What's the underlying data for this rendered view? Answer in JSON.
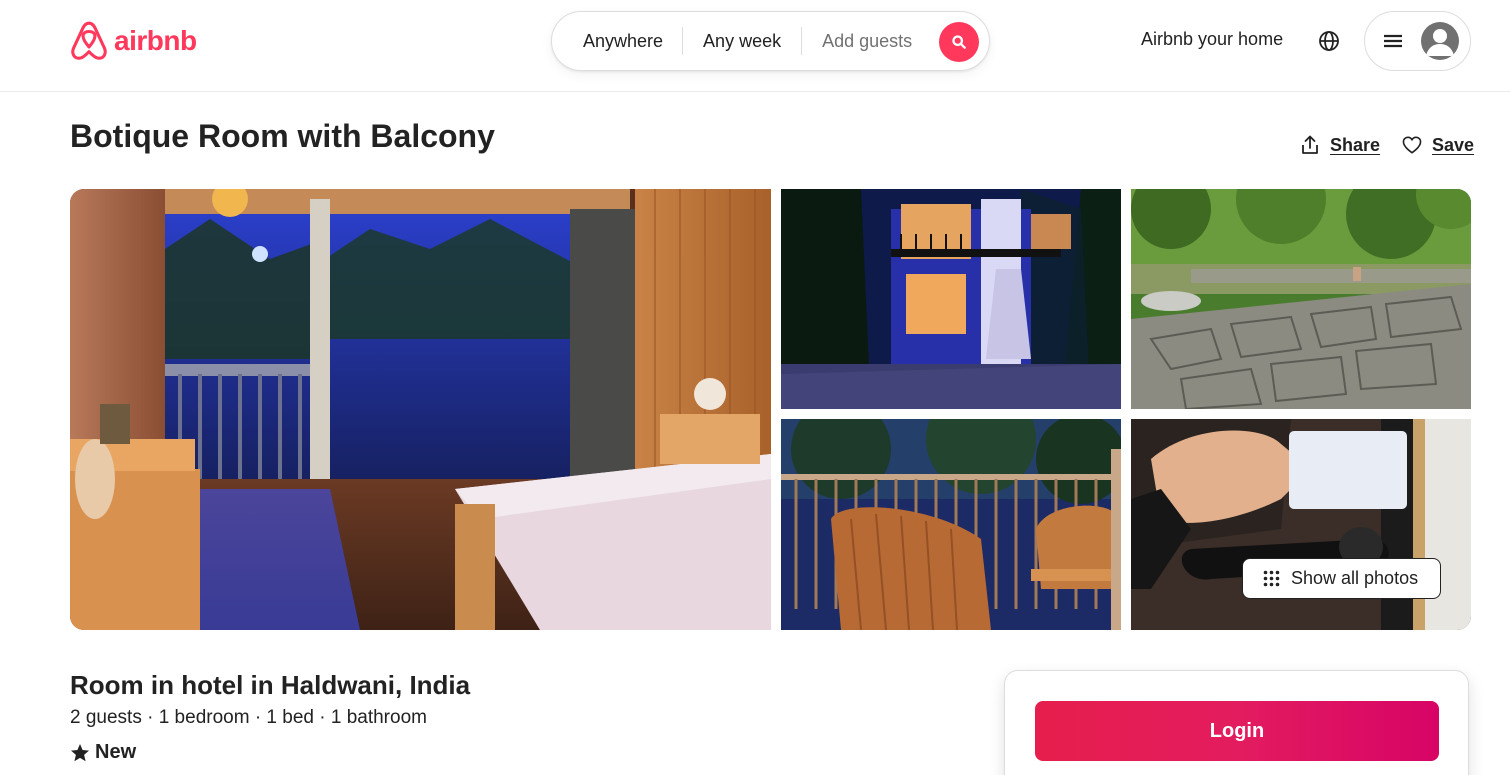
{
  "header": {
    "brand": "airbnb",
    "search": {
      "location": "Anywhere",
      "dates": "Any week",
      "guests": "Add guests"
    },
    "host_link": "Airbnb your home"
  },
  "listing": {
    "title": "Botique Room with Balcony",
    "share_label": "Share",
    "save_label": "Save",
    "show_all_photos": "Show all photos",
    "subtitle": "Room in hotel in Haldwani, India",
    "details": "2 guests · 1 bedroom · 1 bed · 1 bathroom",
    "rating_label": "New"
  },
  "booking": {
    "login_label": "Login"
  },
  "colors": {
    "brand": "#FF385C",
    "text": "#222222",
    "muted": "#717171",
    "border": "#DDDDDD"
  },
  "icons": {
    "search": "search-icon",
    "globe": "globe-icon",
    "menu": "hamburger-icon",
    "user": "user-avatar-icon",
    "share": "share-icon",
    "save": "heart-icon",
    "grid": "grid-dots-icon",
    "star": "star-icon"
  }
}
